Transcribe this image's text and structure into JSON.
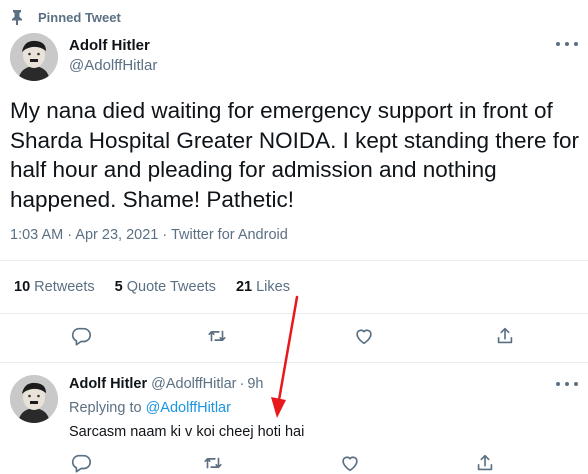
{
  "pinned": {
    "label": "Pinned Tweet",
    "icon": "pin-icon"
  },
  "tweet": {
    "author_name": "Adolf Hitler",
    "author_handle": "@AdolffHitlar",
    "text": "My nana died waiting for emergency support in front of Sharda Hospital Greater NOIDA. I kept standing there for half hour and pleading for admission and nothing happened. Shame! Pathetic!",
    "timestamp": "1:03 AM · Apr 23, 2021 · Twitter for Android",
    "stats": {
      "retweets_count": "10",
      "retweets_label": "Retweets",
      "quotes_count": "5",
      "quotes_label": "Quote Tweets",
      "likes_count": "21",
      "likes_label": "Likes"
    }
  },
  "reply": {
    "author_name": "Adolf Hitler",
    "author_handle": "@AdolffHitlar",
    "separator": "·",
    "time": "9h",
    "replying_prefix": "Replying to ",
    "replying_to": "@AdolffHitlar",
    "text": "Sarcasm naam ki v koi cheej hoti hai"
  },
  "colors": {
    "text": "#0f1419",
    "muted": "#5b7083",
    "link": "#1b95e0",
    "divider": "#e6ecf0",
    "annotation": "#e8191c"
  }
}
